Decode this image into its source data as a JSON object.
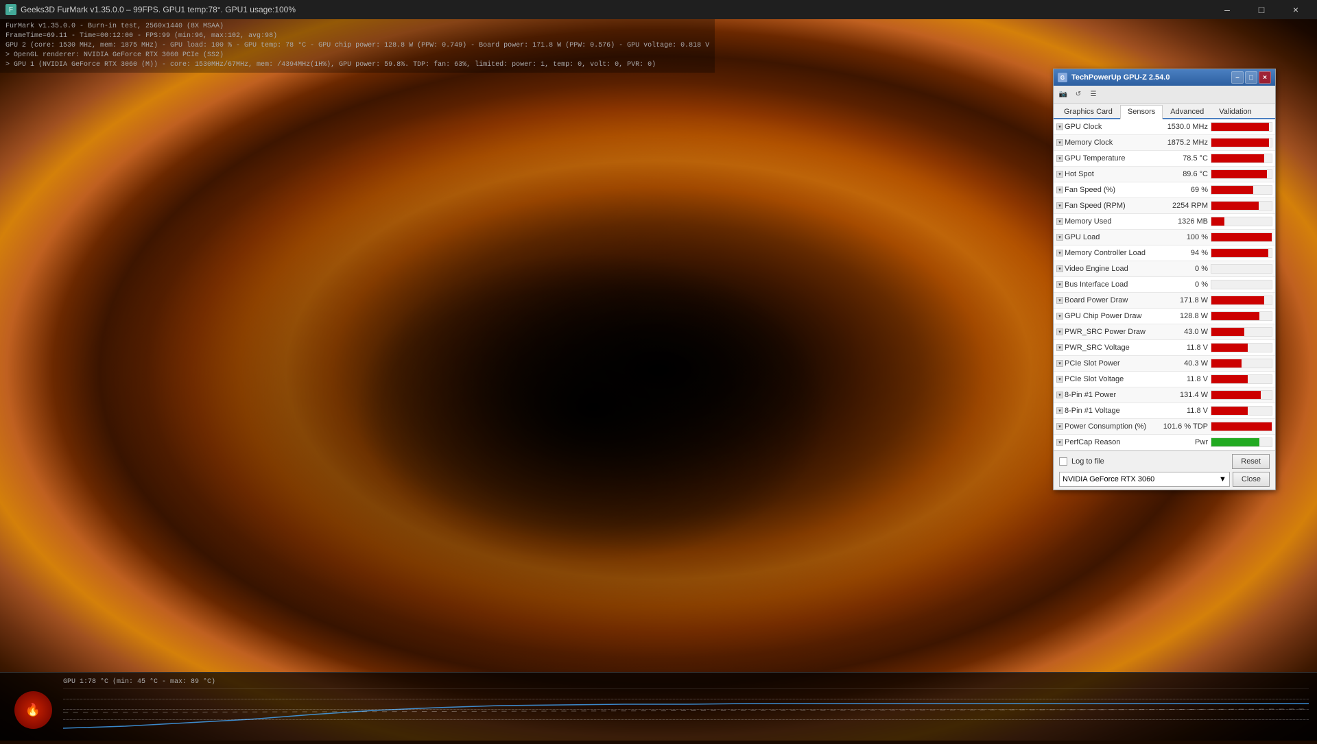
{
  "window": {
    "title": "Geeks3D FurMark v1.35.0.0 – 99FPS. GPU1 temp:78°. GPU1 usage:100%",
    "close": "×",
    "minimize": "–",
    "maximize": "□"
  },
  "debug": {
    "line1": "FurMark v1.35.0.0 - Burn-in test, 2560x1440 (8X MSAA)",
    "line2": "FrameTime=69.11 - Time=00:12:00 - FPS:99 (min:96, max:102, avg:98)",
    "line3": "GPU 2 (core: 1530 MHz, mem: 1875 MHz) - GPU load: 100 % - GPU temp: 78 °C - GPU chip power: 128.8 W (PPW: 0.749) - Board power: 171.8 W (PPW: 0.576) - GPU voltage: 0.818 V",
    "line4": "> OpenGL renderer: NVIDIA GeForce RTX 3060 PCIe (SS2)",
    "line5": "> GPU 1 (NVIDIA GeForce RTX 3060 (M)) - core: 1530MHz/67MHz, mem: /4394MHz(1H%), GPU power: 59.8%. TDP: fan: 63%, limited: power: 1, temp: 0, volt: 0, PVR: 0)"
  },
  "gpuz": {
    "title": "TechPowerUp GPU-Z 2.54.0",
    "tabs": [
      "Graphics Card",
      "Sensors",
      "Advanced",
      "Validation"
    ],
    "active_tab": "Sensors",
    "iconbar": [
      "camera",
      "refresh",
      "menu"
    ],
    "sensors": [
      {
        "name": "GPU Clock",
        "value": "1530.0 MHz",
        "bar_pct": 95,
        "green": false
      },
      {
        "name": "Memory Clock",
        "value": "1875.2 MHz",
        "bar_pct": 95,
        "green": false
      },
      {
        "name": "GPU Temperature",
        "value": "78.5 °C",
        "bar_pct": 88,
        "green": false
      },
      {
        "name": "Hot Spot",
        "value": "89.6 °C",
        "bar_pct": 92,
        "green": false
      },
      {
        "name": "Fan Speed (%)",
        "value": "69 %",
        "bar_pct": 69,
        "green": false
      },
      {
        "name": "Fan Speed (RPM)",
        "value": "2254 RPM",
        "bar_pct": 78,
        "green": false
      },
      {
        "name": "Memory Used",
        "value": "1326 MB",
        "bar_pct": 22,
        "green": false
      },
      {
        "name": "GPU Load",
        "value": "100 %",
        "bar_pct": 100,
        "green": false
      },
      {
        "name": "Memory Controller Load",
        "value": "94 %",
        "bar_pct": 94,
        "green": false
      },
      {
        "name": "Video Engine Load",
        "value": "0 %",
        "bar_pct": 0,
        "green": false
      },
      {
        "name": "Bus Interface Load",
        "value": "0 %",
        "bar_pct": 0,
        "green": false
      },
      {
        "name": "Board Power Draw",
        "value": "171.8 W",
        "bar_pct": 88,
        "green": false
      },
      {
        "name": "GPU Chip Power Draw",
        "value": "128.8 W",
        "bar_pct": 80,
        "green": false
      },
      {
        "name": "PWR_SRC Power Draw",
        "value": "43.0 W",
        "bar_pct": 55,
        "green": false
      },
      {
        "name": "PWR_SRC Voltage",
        "value": "11.8 V",
        "bar_pct": 60,
        "green": false
      },
      {
        "name": "PCIe Slot Power",
        "value": "40.3 W",
        "bar_pct": 50,
        "green": false
      },
      {
        "name": "PCIe Slot Voltage",
        "value": "11.8 V",
        "bar_pct": 60,
        "green": false
      },
      {
        "name": "8-Pin #1 Power",
        "value": "131.4 W",
        "bar_pct": 82,
        "green": false
      },
      {
        "name": "8-Pin #1 Voltage",
        "value": "11.8 V",
        "bar_pct": 60,
        "green": false
      },
      {
        "name": "Power Consumption (%)",
        "value": "101.6 % TDP",
        "bar_pct": 100,
        "green": false
      },
      {
        "name": "PerfCap Reason",
        "value": "Pwr",
        "bar_pct": 80,
        "green": true
      }
    ],
    "log_to_file_label": "Log to file",
    "device": "NVIDIA GeForce RTX 3060",
    "reset_btn": "Reset",
    "close_btn": "Close"
  },
  "graph": {
    "label": "GPU 1:78 °C (min: 45 °C - max: 89 °C)"
  }
}
